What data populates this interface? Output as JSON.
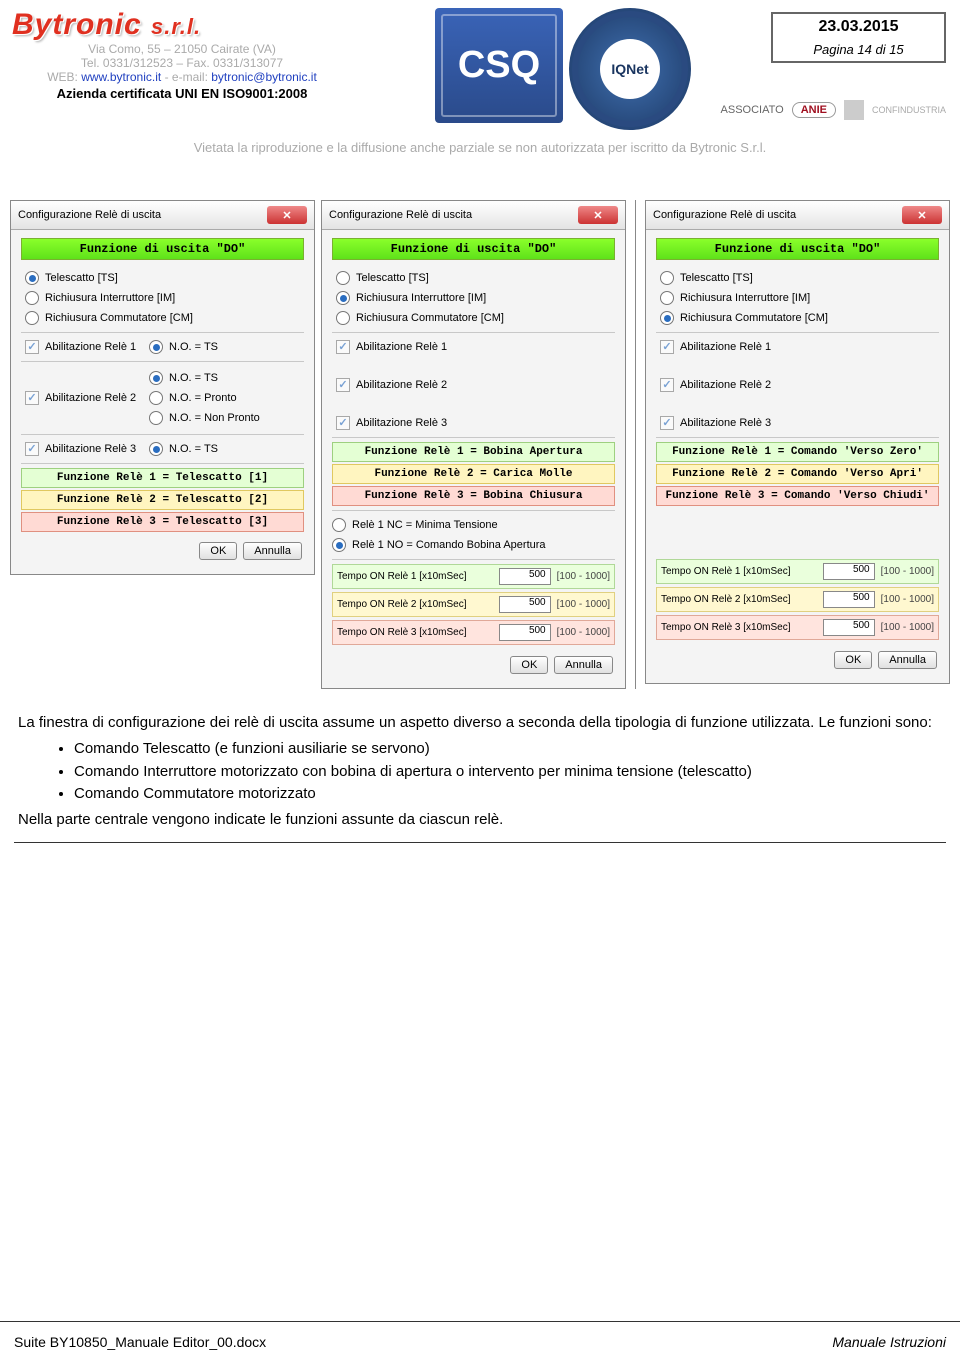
{
  "header": {
    "logo_text": "Bytronic",
    "logo_suffix": "s.r.l.",
    "address_line1": "Via Como, 55 – 21050 Cairate (VA)",
    "address_line2": "Tel. 0331/312523 – Fax. 0331/313077",
    "web_prefix": "WEB: ",
    "web_url": "www.bytronic.it",
    "web_mid": " - e-mail: ",
    "web_email": "bytronic@bytronic.it",
    "cert_line": "Azienda certificata UNI EN ISO9001:2008",
    "disclaimer": "Vietata la riproduzione e la diffusione anche parziale se non autorizzata per iscritto da Bytronic S.r.l.",
    "doc_date": "23.03.2015",
    "doc_page": "Pagina 14 di 15",
    "associato_label": "ASSOCIATO",
    "anie_label": "ANIE",
    "confind_label": "CONFINDUSTRIA",
    "csq_label": "CSQ",
    "iqnet_label": "IQNet"
  },
  "dialog_common": {
    "title": "Configurazione Relè di uscita",
    "green_header": "Funzione di uscita \"DO\"",
    "opt_telescatto": "Telescatto [TS]",
    "opt_interruttore": "Richiusura Interruttore [IM]",
    "opt_commutatore": "Richiusura Commutatore [CM]",
    "abil1": "Abilitazione Relè 1",
    "abil2": "Abilitazione Relè 2",
    "abil3": "Abilitazione Relè 3",
    "ok": "OK",
    "annulla": "Annulla"
  },
  "dialog_a": {
    "no_ts": "N.O. = TS",
    "no_pronto": "N.O. = Pronto",
    "no_nonpronto": "N.O. = Non Pronto",
    "func1": "Funzione Relè 1 = Telescatto [1]",
    "func2": "Funzione Relè 2 = Telescatto [2]",
    "func3": "Funzione Relè 3 = Telescatto [3]"
  },
  "dialog_b": {
    "func1": "Funzione Relè 1 = Bobina Apertura",
    "func2": "Funzione Relè 2 = Carica Molle",
    "func3": "Funzione Relè 3 = Bobina Chiusura",
    "sub_r1nc": "Relè 1 NC = Minima Tensione",
    "sub_r1no": "Relè 1 NO = Comando Bobina Apertura",
    "tempo1_label": "Tempo ON Relè 1 [x10mSec]",
    "tempo2_label": "Tempo ON Relè 2 [x10mSec]",
    "tempo3_label": "Tempo ON Relè 3 [x10mSec]",
    "tempo_value": "500",
    "tempo_range": "[100 - 1000]"
  },
  "dialog_c": {
    "func1": "Funzione Relè 1 = Comando 'Verso Zero'",
    "func2": "Funzione Relè 2 = Comando 'Verso Apri'",
    "func3": "Funzione Relè 3 = Comando 'Verso Chiudi'",
    "tempo1_label": "Tempo ON Relè 1 [x10mSec]",
    "tempo2_label": "Tempo ON Relè 2 [x10mSec]",
    "tempo3_label": "Tempo ON Relè 3 [x10mSec]",
    "tempo_value": "500",
    "tempo_range": "[100 - 1000]"
  },
  "body": {
    "p1": "La finestra di configurazione dei relè di uscita assume un aspetto diverso a seconda della tipologia di funzione utilizzata. Le funzioni sono:",
    "li1": "Comando Telescatto (e funzioni ausiliarie se servono)",
    "li2": "Comando Interruttore motorizzato con bobina di apertura o intervento per minima tensione (telescatto)",
    "li3": "Comando Commutatore motorizzato",
    "p2": "Nella parte centrale vengono indicate le funzioni assunte da ciascun relè."
  },
  "footer": {
    "left": "Suite BY10850_Manuale Editor_00.docx",
    "right": "Manuale Istruzioni"
  }
}
